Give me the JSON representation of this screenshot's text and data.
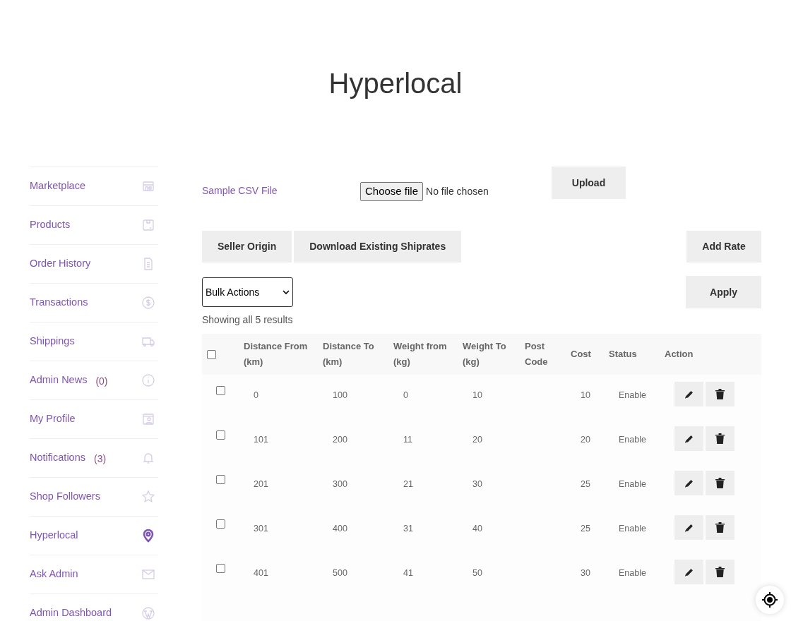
{
  "page_title": "Hyperlocal",
  "sidebar": {
    "items": [
      {
        "label": "Marketplace",
        "selected": false
      },
      {
        "label": "Products",
        "selected": false
      },
      {
        "label": "Order History",
        "selected": false
      },
      {
        "label": "Transactions",
        "selected": false
      },
      {
        "label": "Shippings",
        "selected": false
      },
      {
        "label": "Admin News",
        "count": "(0)",
        "selected": false
      },
      {
        "label": "My Profile",
        "selected": false
      },
      {
        "label": "Notifications",
        "count": "(3)",
        "selected": false
      },
      {
        "label": "Shop Followers",
        "selected": false
      },
      {
        "label": "Hyperlocal",
        "selected": true
      },
      {
        "label": "Ask Admin",
        "selected": false
      },
      {
        "label": "Admin Dashboard",
        "selected": false
      }
    ]
  },
  "upload": {
    "sample_link": "Sample CSV File",
    "file_button": "Choose file",
    "file_status": "No file chosen",
    "upload_button": "Upload"
  },
  "toolbar": {
    "buttons": [
      "Seller Origin",
      "Download Existing Shiprates"
    ],
    "add_button": "Add Rate"
  },
  "bulk": {
    "select": "Bulk Actions",
    "apply": "Apply"
  },
  "result_count": "Showing all 5 results",
  "table": {
    "select_all_checked": false,
    "columns": [
      "Distance From (km)",
      "Distance To (km)",
      "Weight from (kg)",
      "Weight To (kg)",
      "Post Code",
      "Cost",
      "Status",
      "Action"
    ],
    "rows": [
      {
        "checked": false,
        "cells": [
          "0",
          "100",
          "0",
          "10",
          "",
          "10",
          "Enable"
        ]
      },
      {
        "checked": false,
        "cells": [
          "101",
          "200",
          "11",
          "20",
          "",
          "20",
          "Enable"
        ]
      },
      {
        "checked": false,
        "cells": [
          "201",
          "300",
          "21",
          "30",
          "",
          "25",
          "Enable"
        ]
      },
      {
        "checked": false,
        "cells": [
          "301",
          "400",
          "31",
          "40",
          "",
          "25",
          "Enable"
        ]
      },
      {
        "checked": false,
        "cells": [
          "401",
          "500",
          "41",
          "50",
          "",
          "30",
          "Enable"
        ]
      }
    ]
  }
}
